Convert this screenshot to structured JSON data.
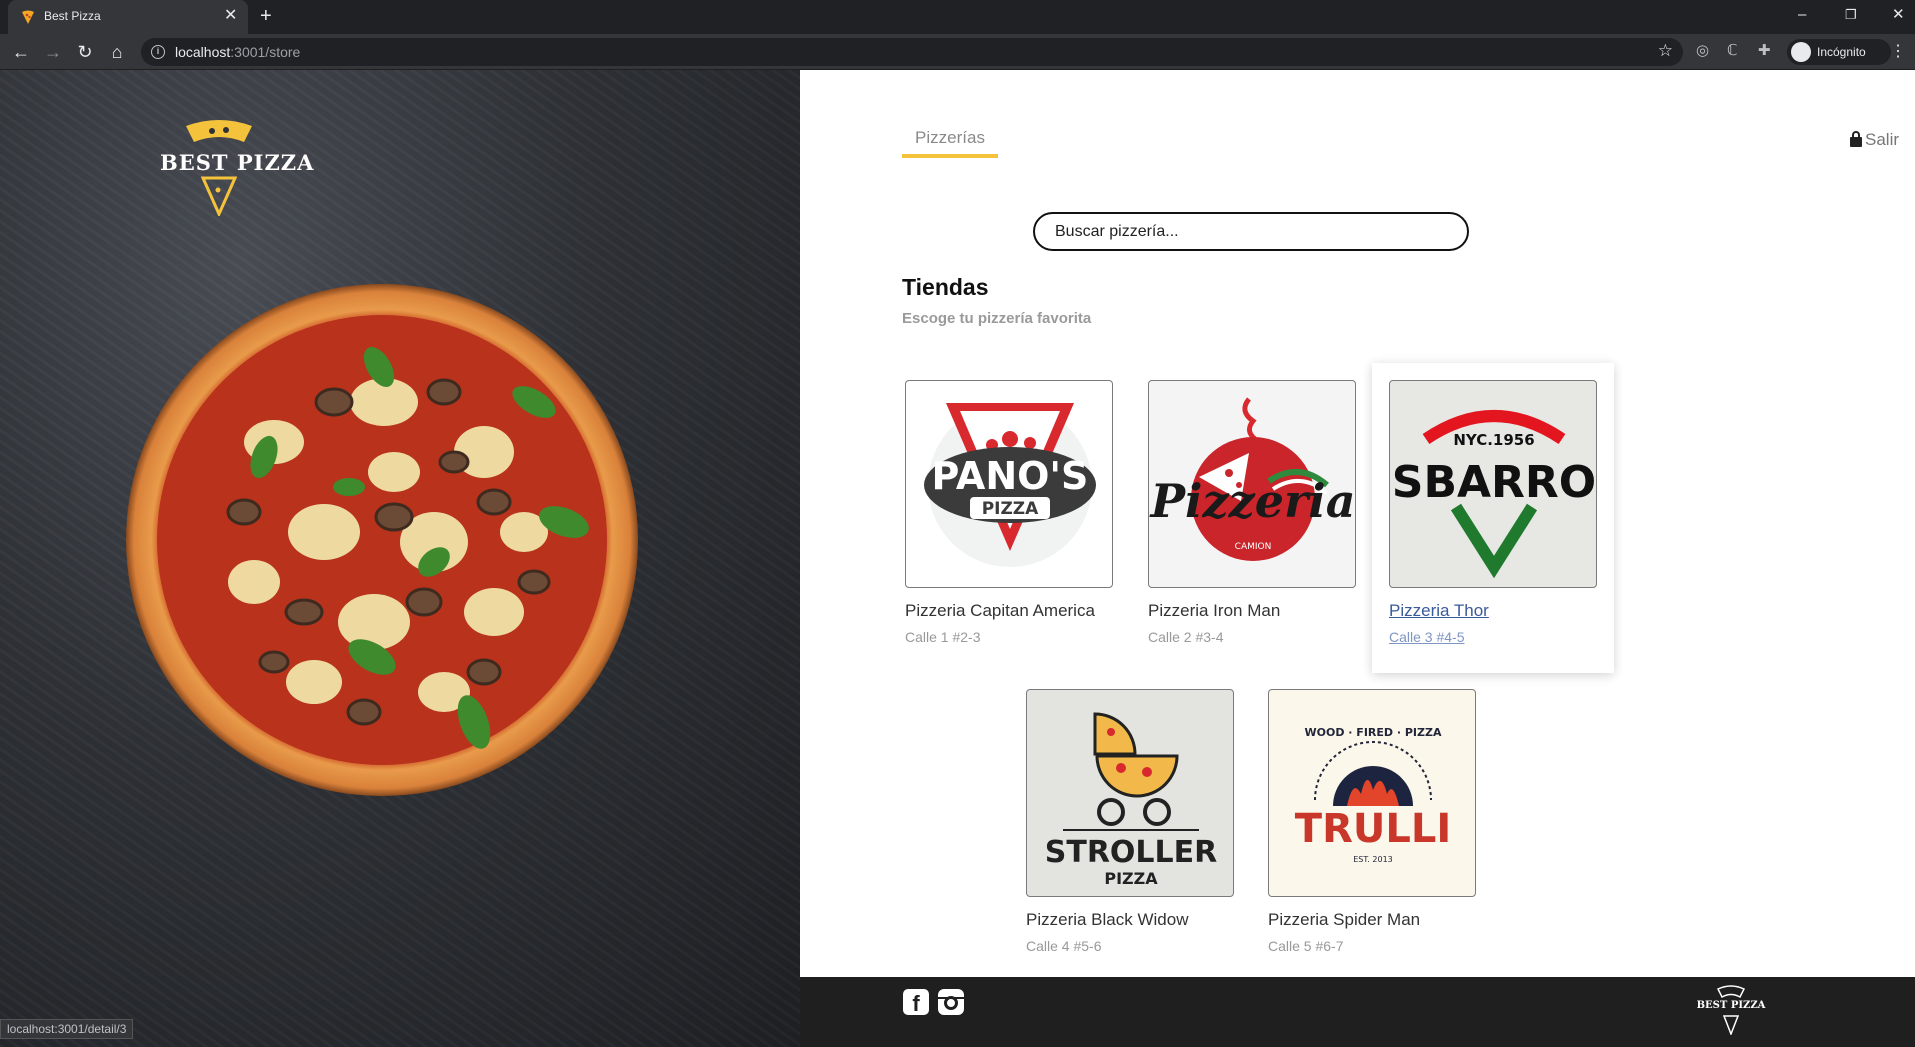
{
  "browser": {
    "tab_title": "Best Pizza",
    "url_host": "localhost",
    "url_path": ":3001/store",
    "profile_label": "Incógnito",
    "status_url": "localhost:3001/detail/3"
  },
  "brand": {
    "logo_text": "BEST PIZZA",
    "accent_color": "#f5c33b"
  },
  "nav": {
    "tab_label": "Pizzerías",
    "logout_label": "Salir"
  },
  "search": {
    "placeholder": "Buscar pizzería..."
  },
  "stores_section": {
    "title": "Tiendas",
    "subtitle": "Escoge tu pizzería favorita",
    "stores": [
      {
        "name": "Pizzeria Capitan America",
        "address": "Calle 1 #2-3",
        "logo": "panos-pizza-logo",
        "logo_text": "PANO'S PIZZA"
      },
      {
        "name": "Pizzeria Iron Man",
        "address": "Calle 2 #3-4",
        "logo": "pizzeria-camion-logo",
        "logo_text": "Pizzeria CAMION"
      },
      {
        "name": "Pizzeria Thor",
        "address": "Calle 3 #4-5",
        "logo": "sbarro-logo",
        "logo_text": "SBARRO NYC.1956",
        "hovered": true
      },
      {
        "name": "Pizzeria Black Widow",
        "address": "Calle 4 #5-6",
        "logo": "stroller-pizza-logo",
        "logo_text": "STROLLER PIZZA"
      },
      {
        "name": "Pizzeria Spider Man",
        "address": "Calle 5 #6-7",
        "logo": "trulli-logo",
        "logo_text": "TRULLI WOOD FIRED PIZZA EST. 2013"
      }
    ]
  },
  "footer": {
    "social": [
      "facebook-icon",
      "instagram-icon"
    ],
    "logo_text": "BEST PIZZA"
  }
}
